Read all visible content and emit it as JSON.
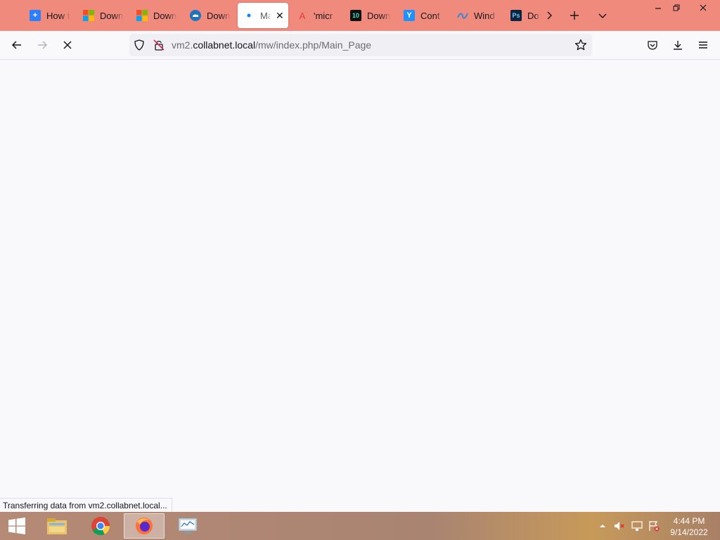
{
  "browser": {
    "tabs": [
      {
        "label": "How t",
        "icon": "plus-square-icon",
        "color": "#2d7ff9"
      },
      {
        "label": "Down",
        "icon": "windows-logo-icon",
        "color": "#f25022"
      },
      {
        "label": "Down",
        "icon": "windows-logo-icon",
        "color": "#f25022"
      },
      {
        "label": "Down",
        "icon": "cloud-icon",
        "color": "#1e73be"
      },
      {
        "label": "Ma",
        "icon": "loading-dot-icon",
        "color": "#0a84ff",
        "active": true
      },
      {
        "label": "'micr",
        "icon": "text-logo-icon",
        "color": "#e33b3b"
      },
      {
        "label": "Down",
        "icon": "app-tile-icon",
        "color": "#0e0e0e"
      },
      {
        "label": "Cont",
        "icon": "y-letter-icon",
        "color": "#1e90ff"
      },
      {
        "label": "Wind",
        "icon": "wave-icon",
        "color": "#3a86d8"
      },
      {
        "label": "Dov",
        "icon": "ps-tile-icon",
        "color": "#0a2540"
      }
    ],
    "address": {
      "prefix": "vm2.",
      "host": "collabnet.local",
      "path": "/mw/index.php/Main_Page"
    },
    "status_text": "Transferring data from vm2.collabnet.local..."
  },
  "taskbar": {
    "apps": [
      {
        "name": "file-explorer-icon"
      },
      {
        "name": "chrome-icon"
      },
      {
        "name": "firefox-icon",
        "active": true
      },
      {
        "name": "resource-monitor-icon"
      }
    ],
    "clock": {
      "time": "4:44 PM",
      "date": "9/14/2022"
    }
  },
  "colors": {
    "tabbar_bg": "#f08a7c",
    "accent": "#0a84ff"
  }
}
